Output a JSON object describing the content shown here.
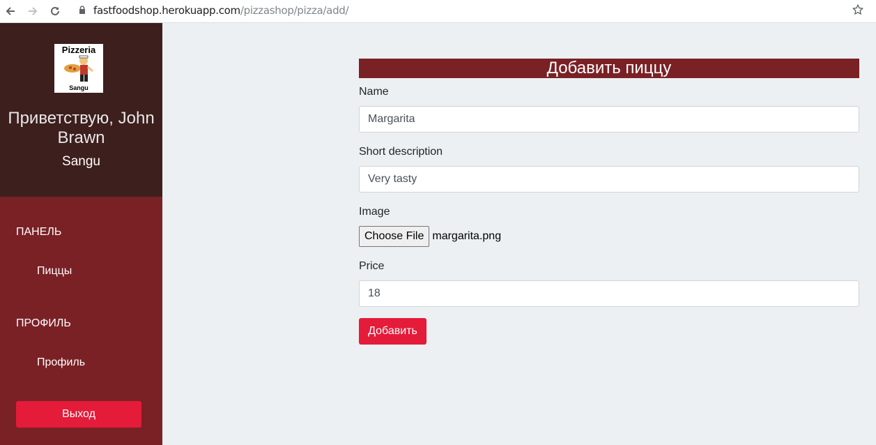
{
  "browser": {
    "url_host": "fastfoodshop.herokuapp.com",
    "url_path": "/pizzashop/pizza/add/"
  },
  "sidebar": {
    "logo_title": "Pizzeria",
    "logo_sub": "Sangu",
    "greeting": "Приветствую, John Brawn",
    "shop_name": "Sangu",
    "panel_title": "ПАНЕЛЬ",
    "pizzas_link": "Пиццы",
    "profile_title": "ПРОФИЛЬ",
    "profile_link": "Профиль",
    "logout_label": "Выход"
  },
  "form": {
    "header": "Добавить пиццу",
    "name_label": "Name",
    "name_value": "Margarita",
    "desc_label": "Short description",
    "desc_value": "Very tasty",
    "image_label": "Image",
    "file_button": "Choose File",
    "file_name": "margarita.png",
    "price_label": "Price",
    "price_value": "18",
    "submit_label": "Добавить"
  },
  "colors": {
    "sidebar_dark": "#3d1f1d",
    "sidebar_red": "#7a2126",
    "accent_red": "#e41b39",
    "main_bg": "#ecf0f3"
  },
  "icons": [
    "back-icon",
    "forward-icon",
    "reload-icon",
    "lock-icon",
    "star-icon"
  ]
}
